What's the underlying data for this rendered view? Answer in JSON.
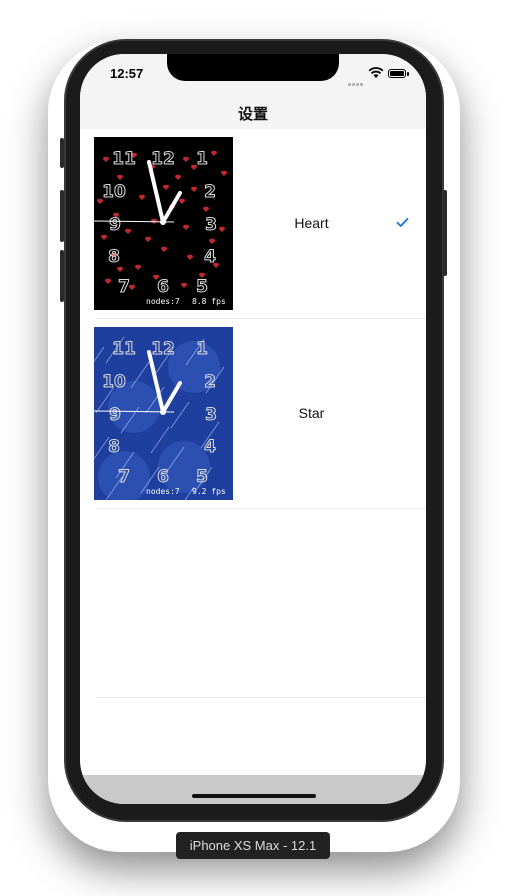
{
  "status_bar": {
    "time": "12:57"
  },
  "nav": {
    "title": "设置"
  },
  "themes": [
    {
      "label": "Heart",
      "selected": true,
      "nodes": "nodes:7",
      "fps": "8.8 fps",
      "background": "#000000",
      "particle_color": "#c0282b"
    },
    {
      "label": "Star",
      "selected": false,
      "nodes": "nodes:7",
      "fps": "9.2 fps",
      "background": "#1e3f9e",
      "particle_color": "#cfe0ff"
    }
  ],
  "clock_numbers": [
    "12",
    "1",
    "2",
    "3",
    "4",
    "5",
    "6",
    "7",
    "8",
    "9",
    "10",
    "11"
  ],
  "accent_color": "#1477d8",
  "device": {
    "label": "iPhone XS Max - 12.1"
  }
}
